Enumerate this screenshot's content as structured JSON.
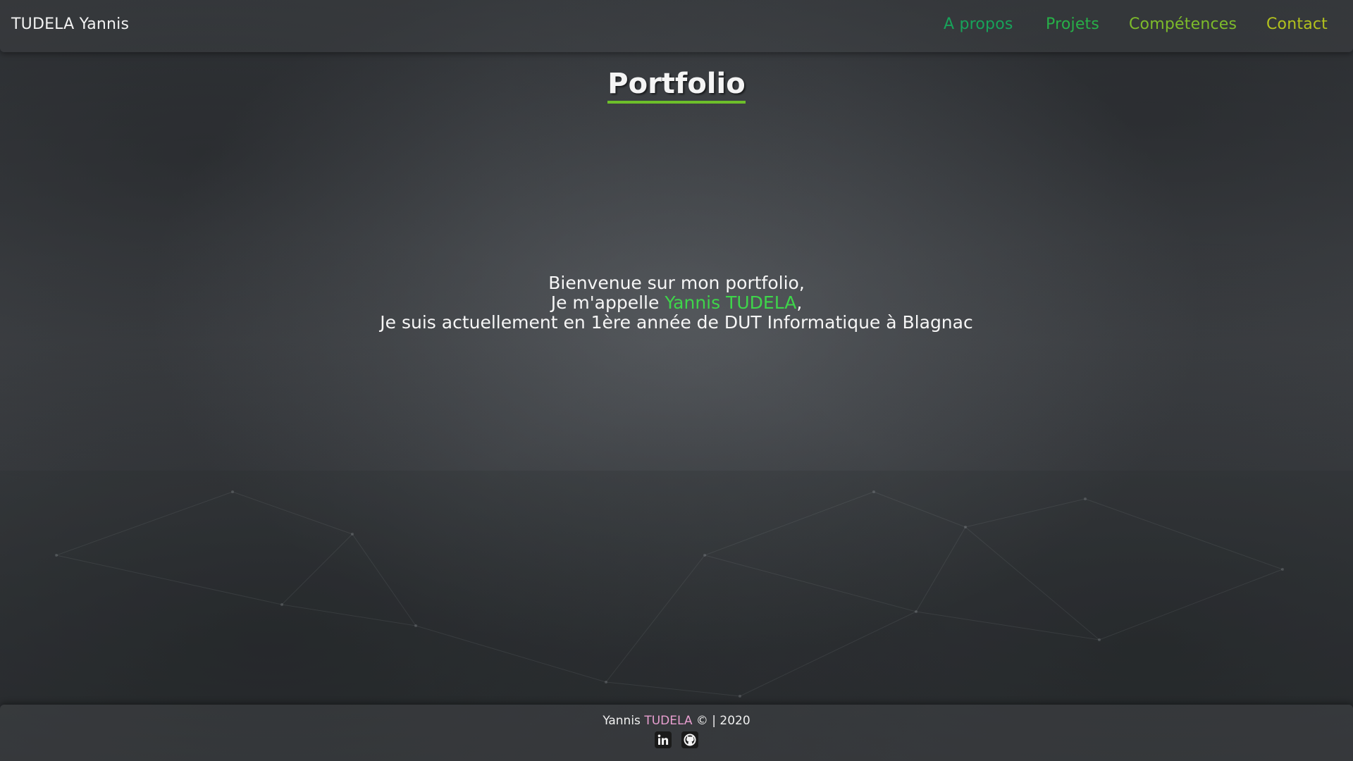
{
  "header": {
    "brand": "TUDELA Yannis",
    "nav": [
      {
        "label": "A propos",
        "color": "#17a35a"
      },
      {
        "label": "Projets",
        "color": "#27b048"
      },
      {
        "label": "Compétences",
        "color": "#7dbb2a"
      },
      {
        "label": "Contact",
        "color": "#b3c21d"
      }
    ]
  },
  "hero": {
    "title": "Portfolio",
    "line1": "Bienvenue sur mon portfolio,",
    "line2_prefix": "Je m'appelle ",
    "line2_name": "Yannis TUDELA",
    "line2_suffix": ",",
    "line3": "Je suis actuellement en 1ère année de DUT Informatique à Blagnac"
  },
  "footer": {
    "name_first": "Yannis ",
    "name_last": "TUDELA",
    "copyright": " © | 2020",
    "socials": [
      {
        "icon": "linkedin-icon"
      },
      {
        "icon": "github-icon"
      }
    ]
  },
  "colors": {
    "accent_green": "#3ed54a",
    "title_underline": "#6dbf2a",
    "footer_accent": "#e89fd0"
  }
}
